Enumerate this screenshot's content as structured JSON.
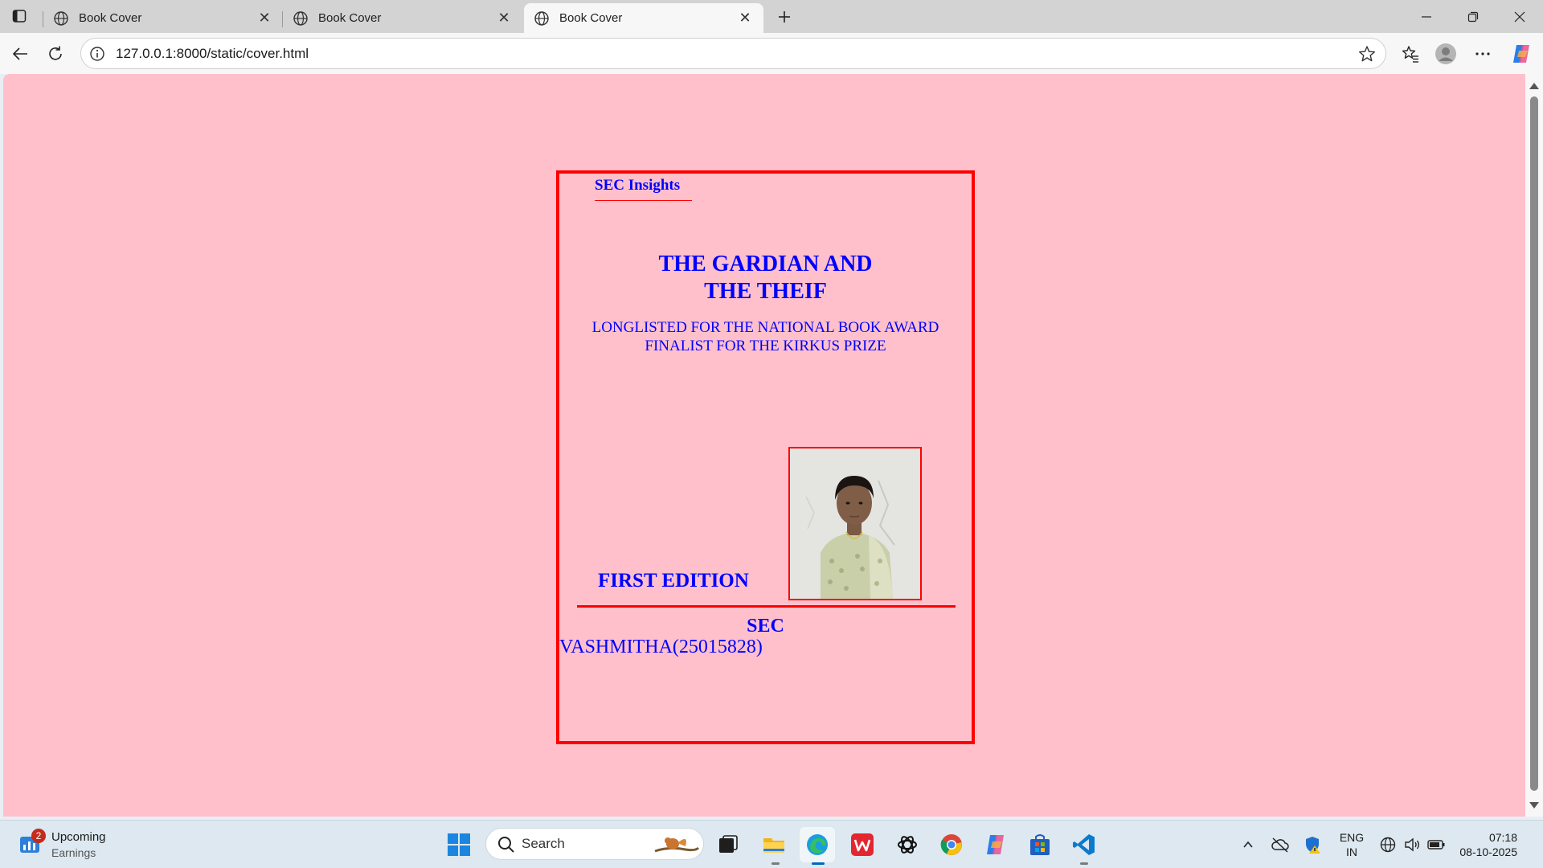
{
  "browser": {
    "tabs": [
      {
        "title": "Book Cover",
        "active": false
      },
      {
        "title": "Book Cover",
        "active": false
      },
      {
        "title": "Book Cover",
        "active": true
      }
    ],
    "url": "127.0.0.1:8000/static/cover.html",
    "page_background": "#ffc0cb"
  },
  "cover": {
    "brand": "SEC Insights",
    "title_line1": "THE GARDIAN AND",
    "title_line2": "THE THEIF",
    "award_line1": "LONGLISTED FOR THE NATIONAL BOOK AWARD",
    "award_line2": "FINALIST FOR THE KIRKUS PRIZE",
    "edition": "FIRST EDITION",
    "publisher": "SEC",
    "author": "VASHMITHA(25015828)",
    "border_color": "#ff0000",
    "text_color": "#0000ff"
  },
  "taskbar": {
    "widget_badge": "2",
    "widget_title": "Upcoming",
    "widget_subtitle": "Earnings",
    "search_placeholder": "Search",
    "language_line1": "ENG",
    "language_line2": "IN",
    "time": "07:18",
    "date": "08-10-2025",
    "accent": "#0067c0"
  }
}
